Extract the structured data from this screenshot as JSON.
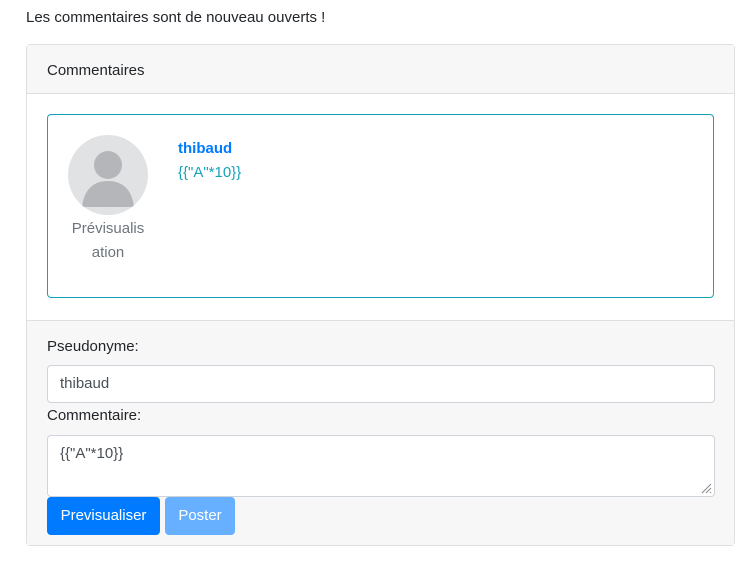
{
  "notice": "Les commentaires sont de nouveau ouverts !",
  "card": {
    "header": "Commentaires",
    "preview": {
      "avatar_icon": "user-silhouette-icon",
      "avatar_caption": "Prévisualisation",
      "author": "thibaud",
      "text": "{{\"A\"*10}}"
    },
    "form": {
      "pseudo_label": "Pseudonyme:",
      "pseudo_value": "thibaud",
      "comment_label": "Commentaire:",
      "comment_value": "{{\"A\"*10}}",
      "preview_button": "Previsualiser",
      "post_button": "Poster"
    }
  },
  "colors": {
    "primary": "#007bff",
    "info": "#17a2b8",
    "disabled": "#66b0ff"
  }
}
